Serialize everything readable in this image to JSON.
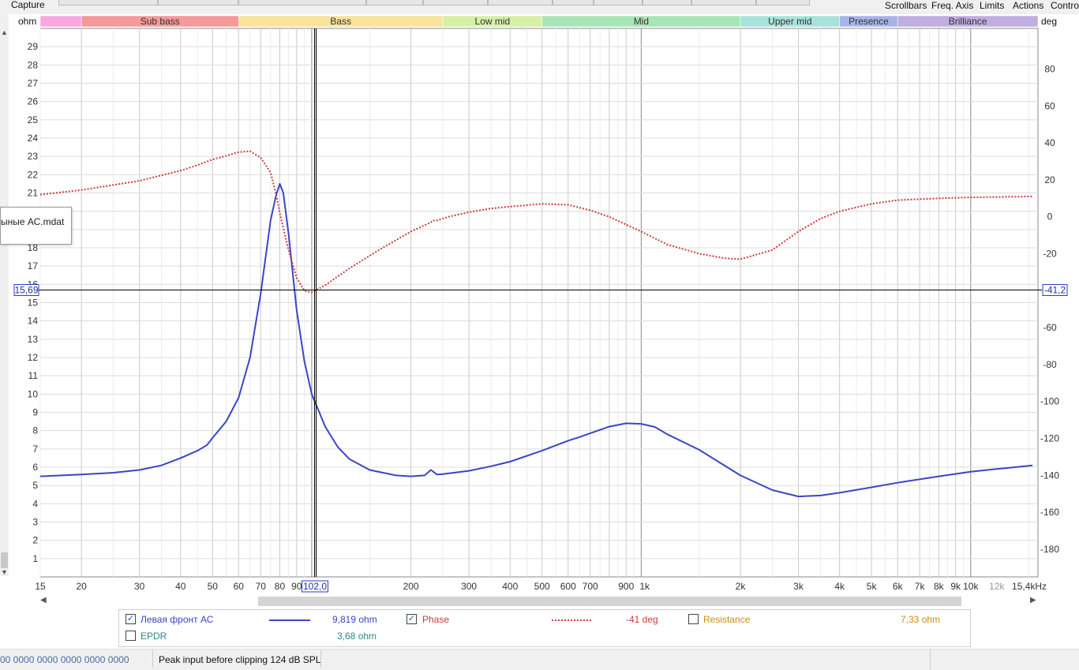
{
  "window": {
    "capture_label": "Capture",
    "menus": [
      "Scrollbars",
      "Freq. Axis",
      "Limits",
      "Actions",
      "Contro"
    ]
  },
  "tooltip": "ыные АС.mdat",
  "chart_data": {
    "type": "line",
    "title": "",
    "x_scale": "log",
    "xlim": [
      15,
      16000
    ],
    "y_left": {
      "label": "ohm",
      "lim": [
        0,
        30
      ],
      "ticks": [
        1,
        2,
        3,
        4,
        5,
        6,
        7,
        8,
        9,
        10,
        11,
        12,
        13,
        14,
        15,
        16,
        17,
        18,
        19,
        20,
        21,
        22,
        23,
        24,
        25,
        26,
        27,
        28,
        29
      ]
    },
    "y_right": {
      "label": "deg",
      "lim": [
        -195,
        102
      ],
      "ticks": [
        80,
        60,
        40,
        20,
        0,
        -20,
        -40,
        -60,
        -80,
        -100,
        -120,
        -140,
        -160,
        -180
      ]
    },
    "x_ticks": [
      {
        "v": 15,
        "l": "15"
      },
      {
        "v": 20,
        "l": "20"
      },
      {
        "v": 30,
        "l": "30"
      },
      {
        "v": 40,
        "l": "40"
      },
      {
        "v": 50,
        "l": "50"
      },
      {
        "v": 60,
        "l": "60"
      },
      {
        "v": 70,
        "l": "70"
      },
      {
        "v": 80,
        "l": "80"
      },
      {
        "v": 90,
        "l": "90"
      },
      {
        "v": 200,
        "l": "200"
      },
      {
        "v": 300,
        "l": "300"
      },
      {
        "v": 400,
        "l": "400"
      },
      {
        "v": 500,
        "l": "500"
      },
      {
        "v": 600,
        "l": "600"
      },
      {
        "v": 700,
        "l": "700"
      },
      {
        "v": 900,
        "l": "900"
      },
      {
        "v": 1000,
        "l": "1k"
      },
      {
        "v": 2000,
        "l": "2k"
      },
      {
        "v": 3000,
        "l": "3k"
      },
      {
        "v": 4000,
        "l": "4k"
      },
      {
        "v": 5000,
        "l": "5k"
      },
      {
        "v": 6000,
        "l": "6k"
      },
      {
        "v": 7000,
        "l": "7k"
      },
      {
        "v": 8000,
        "l": "8k"
      },
      {
        "v": 9000,
        "l": "9k"
      },
      {
        "v": 10000,
        "l": "10k"
      },
      {
        "v": 12000,
        "l": "12k"
      },
      {
        "v": 15400,
        "l": "15,4kHz"
      }
    ],
    "bands": [
      {
        "name": "",
        "from": 15,
        "to": 20,
        "color": "#f7a8df"
      },
      {
        "name": "Sub bass",
        "from": 20,
        "to": 60,
        "color": "#f39a9a"
      },
      {
        "name": "Bass",
        "from": 60,
        "to": 250,
        "color": "#f8e39a"
      },
      {
        "name": "Low mid",
        "from": 250,
        "to": 500,
        "color": "#d6f0a6"
      },
      {
        "name": "Mid",
        "from": 500,
        "to": 2000,
        "color": "#a8e6b8"
      },
      {
        "name": "Upper mid",
        "from": 2000,
        "to": 4000,
        "color": "#a8e2dc"
      },
      {
        "name": "Presence",
        "from": 4000,
        "to": 6000,
        "color": "#a8b4e8"
      },
      {
        "name": "Brilliance",
        "from": 6000,
        "to": 16000,
        "color": "#c0aee0"
      }
    ],
    "cursor": {
      "x": 102,
      "x_label": "102,0",
      "y_left": 15.69,
      "y_left_label": "15,69",
      "y_right_label": "-41,2"
    },
    "series": [
      {
        "name": "Левая фронт АС",
        "axis": "left",
        "color": "#3a46c4",
        "style": "solid",
        "x": [
          15,
          20,
          25,
          30,
          35,
          40,
          45,
          48,
          50,
          55,
          60,
          65,
          70,
          75,
          78,
          80,
          82,
          85,
          90,
          95,
          100,
          110,
          120,
          130,
          150,
          180,
          200,
          220,
          230,
          240,
          250,
          300,
          350,
          400,
          500,
          600,
          650,
          700,
          800,
          900,
          1000,
          1100,
          1200,
          1500,
          2000,
          2500,
          3000,
          3500,
          4000,
          5000,
          6000,
          8000,
          10000,
          12000,
          15400
        ],
        "y": [
          5.5,
          5.6,
          5.7,
          5.85,
          6.1,
          6.5,
          6.9,
          7.2,
          7.6,
          8.5,
          9.8,
          12.0,
          15.5,
          19.5,
          20.9,
          21.5,
          21.0,
          18.8,
          14.6,
          11.8,
          10.0,
          8.2,
          7.1,
          6.45,
          5.85,
          5.55,
          5.5,
          5.55,
          5.85,
          5.6,
          5.62,
          5.8,
          6.05,
          6.3,
          6.9,
          7.45,
          7.65,
          7.85,
          8.22,
          8.4,
          8.37,
          8.2,
          7.8,
          6.95,
          5.55,
          4.75,
          4.4,
          4.45,
          4.6,
          4.9,
          5.15,
          5.5,
          5.75,
          5.9,
          6.1
        ]
      },
      {
        "name": "Phase",
        "axis": "right",
        "color": "#cc3b3b",
        "style": "dotted",
        "x": [
          15,
          20,
          30,
          40,
          45,
          50,
          55,
          60,
          65,
          70,
          75,
          78,
          80,
          85,
          90,
          95,
          100,
          110,
          130,
          160,
          200,
          230,
          233,
          240,
          260,
          300,
          350,
          400,
          500,
          600,
          700,
          800,
          1000,
          1200,
          1500,
          1800,
          2000,
          2500,
          3000,
          3500,
          4000,
          5000,
          6000,
          8000,
          10000,
          15400
        ],
        "y": [
          12,
          14.5,
          19.5,
          25,
          28,
          31,
          33,
          35,
          35.5,
          32,
          24,
          12,
          2,
          -18,
          -33,
          -40,
          -41,
          -37,
          -28,
          -18,
          -8,
          -3,
          -2,
          -2,
          0,
          2.5,
          4.5,
          5.5,
          7,
          6.5,
          3.5,
          0,
          -8,
          -15,
          -20,
          -22.5,
          -23,
          -18,
          -8,
          -1,
          3,
          7,
          9,
          10,
          10.5,
          11
        ]
      }
    ]
  },
  "legend": {
    "items": [
      {
        "label": "Левая фронт АС",
        "checked": true,
        "value": "9,819 ohm",
        "label_color": "#3a46c4",
        "value_color": "#3a46c4"
      },
      {
        "label": "Phase",
        "checked": true,
        "value": "-41 deg",
        "label_color": "#cc3b3b",
        "value_color": "#cc3b3b"
      },
      {
        "label": "Resistance",
        "checked": false,
        "value": "7,33 ohm",
        "label_color": "#c8900e",
        "value_color": "#c8900e"
      },
      {
        "label": "EPDR",
        "checked": false,
        "value": "3,68 ohm",
        "label_color": "#2a8a8a",
        "value_color": "#2a8a8a"
      }
    ]
  },
  "status": {
    "left": "00 0000  0000 0000  0000 0000",
    "peak": "Peak input before clipping 124 dB SPL"
  }
}
